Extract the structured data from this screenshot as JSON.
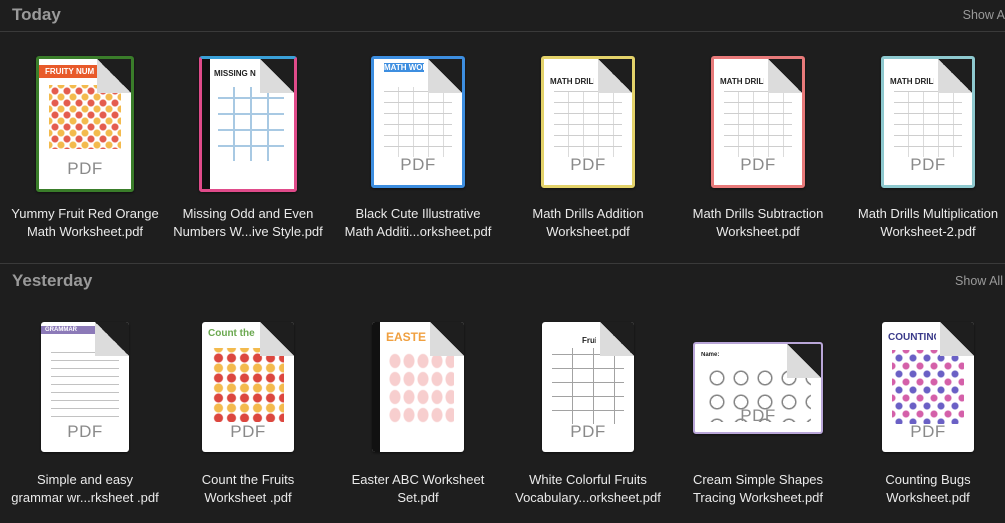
{
  "sections": [
    {
      "title": "Today",
      "show_all": "Show A",
      "files": [
        {
          "line1": "Yummy Fruit Red Orange",
          "line2": "Math Worksheet.pdf",
          "thumb_title": "FRUITY NUM",
          "badge": "PDF",
          "accent": "#3a7d2a"
        },
        {
          "line1": "Missing Odd and Even",
          "line2": "Numbers W...ive Style.pdf",
          "thumb_title": "MISSING NU",
          "badge": "",
          "accent": "#e04b8a"
        },
        {
          "line1": "Black Cute Illustrative",
          "line2": "Math Additi...orksheet.pdf",
          "thumb_title": "MATH WORK",
          "badge": "PDF",
          "accent": "#3d8ee0"
        },
        {
          "line1": "Math Drills Addition",
          "line2": "Worksheet.pdf",
          "thumb_title": "MATH DRILLS: A",
          "badge": "PDF",
          "accent": "#e3d26a"
        },
        {
          "line1": "Math Drills Subtraction",
          "line2": "Worksheet.pdf",
          "thumb_title": "MATH DRILLS: SUB",
          "badge": "PDF",
          "accent": "#e87a7a"
        },
        {
          "line1": "Math Drills Multiplication",
          "line2": "Worksheet-2.pdf",
          "thumb_title": "MATH DRILLS: MULT",
          "badge": "PDF",
          "accent": "#8ec9cf"
        }
      ]
    },
    {
      "title": "Yesterday",
      "show_all": "Show All",
      "files": [
        {
          "line1": "Simple and easy",
          "line2": "grammar wr...rksheet .pdf",
          "thumb_title": "GRAMMAR",
          "badge": "PDF",
          "accent": "#8c7ab8"
        },
        {
          "line1": "Count the Fruits",
          "line2": "Worksheet .pdf",
          "thumb_title": "Count the",
          "badge": "PDF",
          "accent": "#6aa84f"
        },
        {
          "line1": "Easter ABC Worksheet",
          "line2": "Set.pdf",
          "thumb_title": "EASTER",
          "badge": "",
          "accent": "#f0a040"
        },
        {
          "line1": "White Colorful Fruits",
          "line2": "Vocabulary...orksheet.pdf",
          "thumb_title": "Fruits",
          "badge": "PDF",
          "accent": "#cfcfcf"
        },
        {
          "line1": "Cream Simple Shapes",
          "line2": "Tracing Worksheet.pdf",
          "thumb_title": "Name:",
          "badge": "PDF",
          "accent": "#b9a6d8"
        },
        {
          "line1": "Counting Bugs",
          "line2": "Worksheet.pdf",
          "thumb_title": "COUNTING",
          "badge": "PDF",
          "accent": "#3a3a8a"
        }
      ]
    }
  ]
}
